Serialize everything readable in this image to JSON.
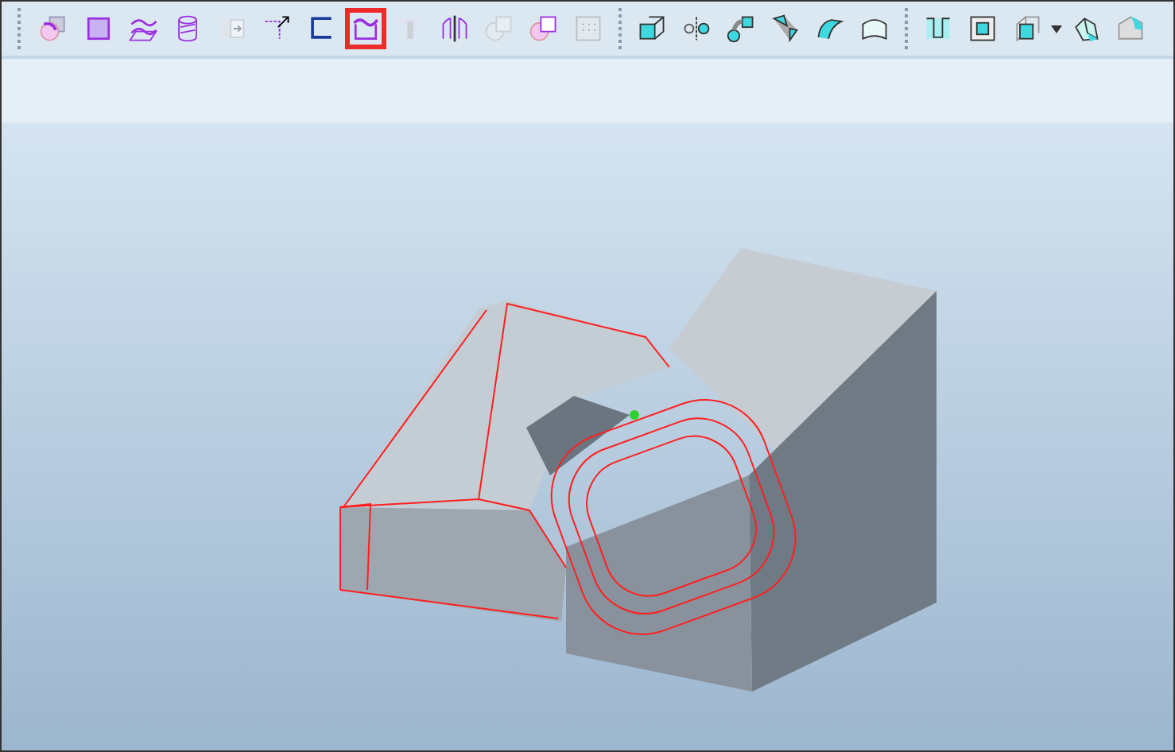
{
  "toolbar": {
    "groups": [
      {
        "buttons": [
          {
            "kind": "round",
            "selected": false,
            "disabled": false
          },
          {
            "kind": "fill",
            "selected": false,
            "disabled": false
          },
          {
            "kind": "merge",
            "selected": false,
            "disabled": false
          },
          {
            "kind": "offset",
            "selected": false,
            "disabled": false
          },
          {
            "kind": "copy",
            "selected": false,
            "disabled": true
          },
          {
            "kind": "extend",
            "selected": false,
            "disabled": false
          },
          {
            "kind": "trim",
            "selected": false,
            "disabled": false
          },
          {
            "kind": "intersect",
            "selected": true,
            "disabled": false
          },
          {
            "kind": "project",
            "selected": false,
            "disabled": true
          },
          {
            "kind": "mirror",
            "selected": false,
            "disabled": false
          },
          {
            "kind": "union",
            "selected": false,
            "disabled": true
          },
          {
            "kind": "remove",
            "selected": false,
            "disabled": false
          },
          {
            "kind": "pattern",
            "selected": false,
            "disabled": true
          }
        ]
      },
      {
        "buttons": [
          {
            "kind": "extrude",
            "selected": false,
            "disabled": false
          },
          {
            "kind": "revolve",
            "selected": false,
            "disabled": false
          },
          {
            "kind": "sweep",
            "selected": false,
            "disabled": false
          },
          {
            "kind": "blend",
            "selected": false,
            "disabled": false
          },
          {
            "kind": "boundary",
            "selected": false,
            "disabled": false
          },
          {
            "kind": "patch",
            "selected": false,
            "disabled": false
          }
        ]
      },
      {
        "buttons": [
          {
            "kind": "hole",
            "selected": false,
            "disabled": false
          },
          {
            "kind": "shell",
            "selected": false,
            "disabled": false
          },
          {
            "kind": "rib",
            "selected": false,
            "disabled": false,
            "menu": true
          },
          {
            "kind": "draft",
            "selected": false,
            "disabled": false
          },
          {
            "kind": "corner",
            "selected": false,
            "disabled": false
          }
        ]
      }
    ]
  }
}
